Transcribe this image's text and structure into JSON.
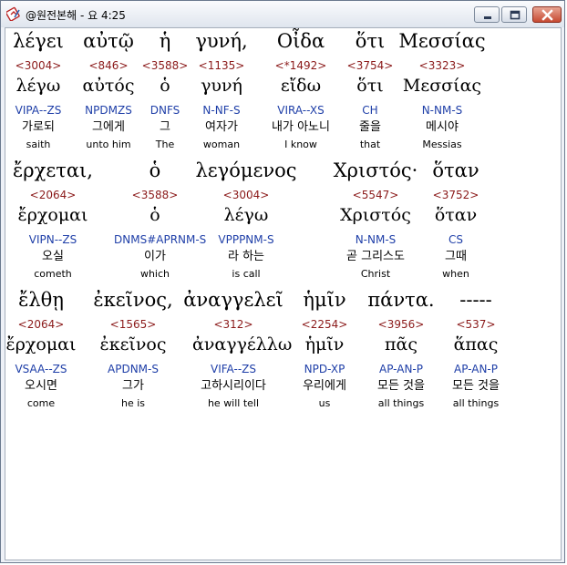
{
  "window": {
    "title": "@원전본해 - 요 4:25",
    "icon": "bible-app-icon",
    "controls": [
      "minimize-icon",
      "maximize-icon",
      "close-icon"
    ]
  },
  "lines": [
    {
      "words": [
        {
          "greek": "λέγει",
          "num": "<3004>",
          "lemma": "λέγω",
          "morph": "VIPA--ZS",
          "kor": "가로되",
          "eng": "saith"
        },
        {
          "greek": "αὐτῷ",
          "num": "<846>",
          "lemma": "αὐτός",
          "morph": "NPDMZS",
          "kor": "그에게",
          "eng": "unto him"
        },
        {
          "greek": "ἡ",
          "num": "<3588>",
          "lemma": "ὁ",
          "morph": "DNFS",
          "kor": "그",
          "eng": "The"
        },
        {
          "greek": "γυνή,",
          "num": "<1135>",
          "lemma": "γυνή",
          "morph": "N-NF-S",
          "kor": "여자가",
          "eng": "woman"
        },
        {
          "greek": "Οἶδα",
          "num": "<*1492>",
          "lemma": "εἴδω",
          "morph": "VIRA--XS",
          "kor": "내가 아노니",
          "eng": "I know"
        },
        {
          "greek": "ὅτι",
          "num": "<3754>",
          "lemma": "ὅτι",
          "morph": "CH",
          "kor": "줄을",
          "eng": "that"
        },
        {
          "greek": "Μεσσίας",
          "num": "<3323>",
          "lemma": "Μεσσίας",
          "morph": "N-NM-S",
          "kor": "메시야",
          "eng": "Messias"
        }
      ]
    },
    {
      "words": [
        {
          "greek": "ἔρχεται,",
          "num": "<2064>",
          "lemma": "ἔρχομαι",
          "morph": "VIPN--ZS",
          "kor": "오실",
          "eng": "cometh"
        },
        {
          "greek": "ὁ",
          "num": "<3588>",
          "lemma": "ὁ",
          "morph": "DNMS#APRNM-S",
          "kor": "이가",
          "eng": "which"
        },
        {
          "greek": "λεγόμενος",
          "num": "<3004>",
          "lemma": "λέγω",
          "morph": "VPPPNM-S",
          "kor": "라 하는",
          "eng": "is call"
        },
        {
          "greek": "Χριστός·",
          "num": "<5547>",
          "lemma": "Χριστός",
          "morph": "N-NM-S",
          "kor": "곧 그리스도",
          "eng": "Christ"
        },
        {
          "greek": "ὅταν",
          "num": "<3752>",
          "lemma": "ὅταν",
          "morph": "CS",
          "kor": "그때",
          "eng": "when"
        }
      ]
    },
    {
      "words": [
        {
          "greek": "ἔλθῃ",
          "num": "<2064>",
          "lemma": "ἔρχομαι",
          "morph": "VSAA--ZS",
          "kor": "오시면",
          "eng": "come"
        },
        {
          "greek": "ἐκεῖνος,",
          "num": "<1565>",
          "lemma": "ἐκεῖνος",
          "morph": "APDNM-S",
          "kor": "그가",
          "eng": "he is"
        },
        {
          "greek": "ἀναγγελεῖ",
          "num": "<312>",
          "lemma": "ἀναγγέλλω",
          "morph": "VIFA--ZS",
          "kor": "고하시리이다",
          "eng": "he will tell"
        },
        {
          "greek": "ἡμῖν",
          "num": "<2254>",
          "lemma": "ἡμῖν",
          "morph": "NPD-XP",
          "kor": "우리에게",
          "eng": "us"
        },
        {
          "greek": "πάντα.",
          "num": "<3956>",
          "lemma": "πᾶς",
          "morph": "AP-AN-P",
          "kor": "모든 것을",
          "eng": "all things"
        },
        {
          "greek": "-----",
          "num": "<537>",
          "lemma": "ἅπας",
          "morph": "AP-AN-P",
          "kor": "모든 것을",
          "eng": "all things"
        }
      ]
    }
  ]
}
